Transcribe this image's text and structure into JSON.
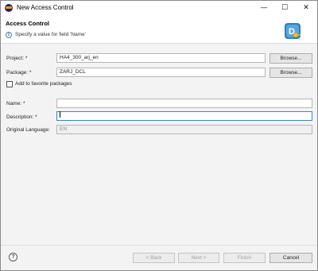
{
  "window": {
    "title": "New Access Control",
    "minimize_glyph": "—",
    "maximize_glyph": "☐",
    "close_glyph": "✕"
  },
  "header": {
    "title": "Access Control",
    "message": "Specify a value for field 'Name'",
    "info_icon_glyph": "i"
  },
  "form": {
    "project": {
      "label": "Project: *",
      "value": "HA4_300_arj_en",
      "browse_label": "Browse..."
    },
    "package": {
      "label": "Package: *",
      "value": "ZARJ_DCL",
      "browse_label": "Browse..."
    },
    "favorite": {
      "label": "Add to favorite packages",
      "checked": false
    },
    "name": {
      "label": "Name: *",
      "value": ""
    },
    "description": {
      "label": "Description: *",
      "value": ""
    },
    "original_language": {
      "label": "Original Language:",
      "value": "EN"
    }
  },
  "footer": {
    "help_glyph": "?",
    "back_label": "< Back",
    "next_label": "Next >",
    "finish_label": "Finish",
    "cancel_label": "Cancel"
  },
  "colors": {
    "accent": "#3c7fd0",
    "window_bg": "#f3f3f3",
    "header_bg": "#ffffff"
  }
}
